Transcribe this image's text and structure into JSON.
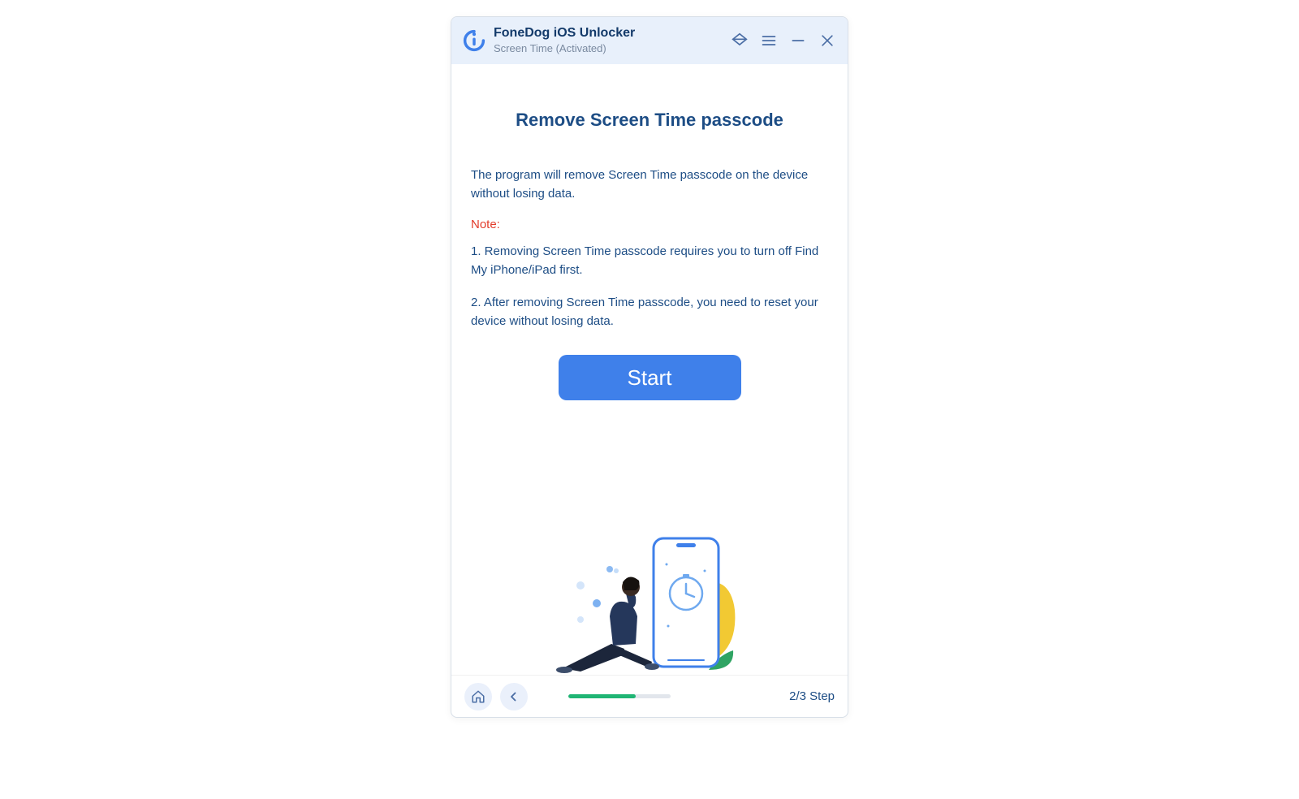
{
  "header": {
    "app_title": "FoneDog iOS Unlocker",
    "subtitle": "Screen Time  (Activated)"
  },
  "main": {
    "heading": "Remove Screen Time passcode",
    "description": "The program will remove Screen Time passcode on the device without losing data.",
    "note_label": "Note:",
    "notes": [
      "1. Removing Screen Time passcode requires you to turn off Find My iPhone/iPad first.",
      "2. After removing Screen Time passcode, you need to reset your device without losing data."
    ],
    "start_button": "Start"
  },
  "footer": {
    "step_label": "2/3 Step",
    "progress_percent": 66
  },
  "colors": {
    "accent": "#3f80ea",
    "heading": "#1d4d85",
    "note_red": "#e23b2a",
    "progress_green": "#1fb574"
  }
}
